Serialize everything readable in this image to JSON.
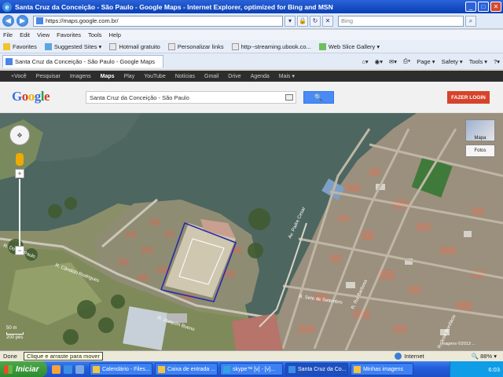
{
  "window": {
    "title": "Santa Cruz da Conceição - São Paulo - Google Maps - Internet Explorer, optimized for Bing and MSN"
  },
  "addressbar": {
    "url": "https://maps.google.com.br/",
    "search_placeholder": "Bing"
  },
  "menu": [
    "File",
    "Edit",
    "View",
    "Favorites",
    "Tools",
    "Help"
  ],
  "favorites": {
    "label": "Favorites",
    "items": [
      "Suggested Sites ▾",
      "Hotmail gratuito",
      "Personalizar links",
      "http--streaming.ubook.co...",
      "Web Slice Gallery ▾"
    ]
  },
  "tab": {
    "label": "Santa Cruz da Conceição - São Paulo - Google Maps"
  },
  "commandbar": [
    "Page ▾",
    "Safety ▾",
    "Tools ▾"
  ],
  "google_bar": {
    "items": [
      "+Você",
      "Pesquisar",
      "Imagens",
      "Maps",
      "Play",
      "YouTube",
      "Notícias",
      "Gmail",
      "Drive",
      "Agenda",
      "Mais ▾"
    ],
    "active_index": 3
  },
  "google": {
    "logo": [
      "G",
      "o",
      "o",
      "g",
      "l",
      "e"
    ],
    "search_value": "Santa Cruz da Conceição - São Paulo",
    "search_button": "🔍",
    "login_button": "FAZER LOGIN"
  },
  "map": {
    "type_main": "Mapa",
    "type_secondary": "Fotos",
    "scale_top": "50 m",
    "scale_bottom": "200 pés",
    "credit": "Imagens ©2013 ...",
    "labels": {
      "street_left": "R. Doutor Paulo",
      "street_mid": "R. Cândido Rodrigues",
      "street_bottom": "R. Joaquim Bueno",
      "street_right": "R. Rui Barbosa",
      "street_vertical": "R. José Bonifácio",
      "street_bottom2": "R. Sete de Setembro",
      "street_rot": "Av. Padre Cesar"
    }
  },
  "statusbar": {
    "left": "Done",
    "tooltip": "Clique e arraste para mover",
    "zone": "Internet",
    "zoom": "🔍 88% ▾"
  },
  "taskbar": {
    "start": "Iniciar",
    "tasks": [
      "Calendário - Files...",
      "Caixa de entrada ...",
      "skype™ [v] - [v]...",
      "Santa Cruz da Co...",
      "Minhas imagens"
    ],
    "active_task": 3,
    "clock": "6:03"
  },
  "colors": {
    "title_bar": "#0a3fb5",
    "google_blue": "#4a8af4",
    "login_red": "#d6432b",
    "water": "#4d6660",
    "taskbar": "#245edb",
    "start_green": "#2e8b30"
  }
}
